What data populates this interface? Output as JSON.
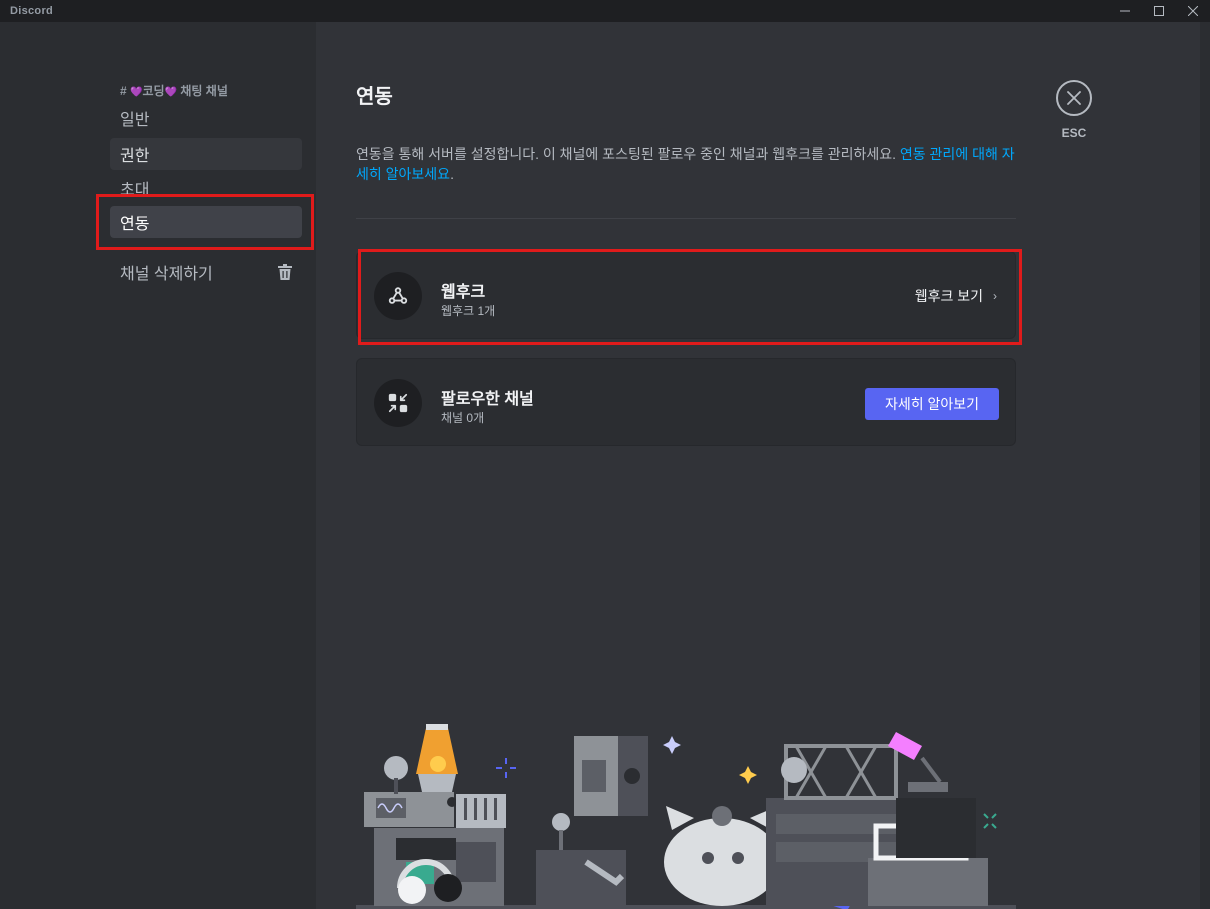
{
  "window": {
    "app_name": "Discord",
    "controls": {
      "minimize": "—",
      "maximize": "☐",
      "close": "✕"
    }
  },
  "sidebar": {
    "channel_prefix": "#",
    "channel_heart": "💜",
    "channel_name_part1": "코딩",
    "channel_name_part2": "채팅 채널",
    "items": [
      {
        "label": "일반"
      },
      {
        "label": "권한"
      },
      {
        "label": "초대"
      },
      {
        "label": "연동"
      }
    ],
    "delete_label": "채널 삭제하기"
  },
  "main": {
    "title": "연동",
    "description_text": "연동을 통해 서버를 설정합니다. 이 채널에 포스팅된 팔로우 중인 채널과 웹후크를 관리하세요. ",
    "description_link": "연동 관리에 대해 자세히 알아보세요",
    "description_end": ".",
    "cards": [
      {
        "title": "웹후크",
        "subtitle": "웹후크 1개",
        "action": "웹후크 보기",
        "action_chevron": "›"
      },
      {
        "title": "팔로우한 채널",
        "subtitle": "채널 0개",
        "action": "자세히 알아보기"
      }
    ],
    "esc_label": "ESC"
  },
  "colors": {
    "accent": "#5865f2",
    "link": "#00a8fc",
    "highlight": "#e01b1b"
  }
}
